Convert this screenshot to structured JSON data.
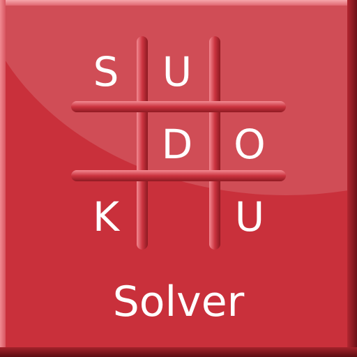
{
  "app_icon": {
    "letters": [
      "S",
      "U",
      "D",
      "O",
      "K",
      "U"
    ],
    "subtitle": "Solver",
    "colors": {
      "background": "#c9303b",
      "grid_line": "#c42f3a",
      "text": "#ffffff"
    }
  }
}
